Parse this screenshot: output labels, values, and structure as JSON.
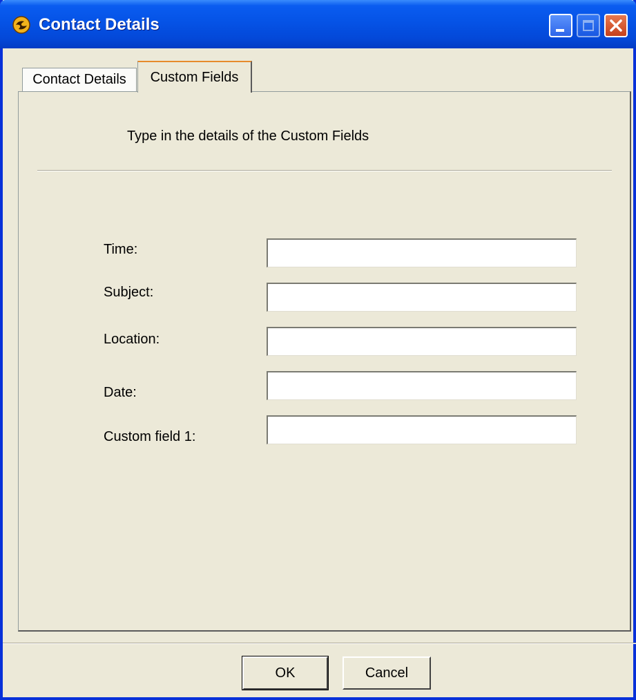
{
  "window": {
    "title": "Contact Details",
    "icon": "app-logo-icon",
    "controls": [
      "minimize-icon",
      "maximize-icon",
      "close-icon"
    ]
  },
  "tabs": [
    {
      "label": "Contact Details",
      "active": false
    },
    {
      "label": "Custom Fields",
      "active": true
    }
  ],
  "page": {
    "instructions": "Type in the details of the Custom Fields"
  },
  "fields": [
    {
      "label": "Time:",
      "value": ""
    },
    {
      "label": "Subject:",
      "value": ""
    },
    {
      "label": "Location:",
      "value": ""
    },
    {
      "label": "Date:",
      "value": ""
    },
    {
      "label": "Custom field 1:",
      "value": ""
    }
  ],
  "buttons": {
    "ok": "OK",
    "cancel": "Cancel"
  },
  "colors": {
    "titlebar": "#0553e6",
    "face": "#ece9d8",
    "close": "#c6401c",
    "tab_highlight": "#e68b2c"
  }
}
